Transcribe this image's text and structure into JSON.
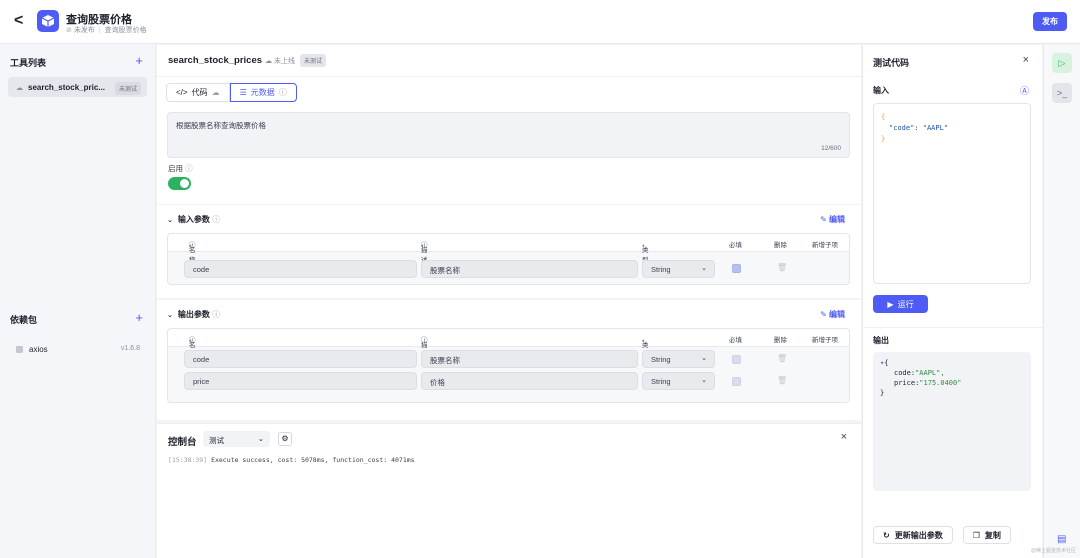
{
  "header": {
    "back_glyph": "<",
    "title": "查询股票价格",
    "status": "未发布",
    "subtitle": "查询股票价格",
    "publish_label": "发布"
  },
  "tools_panel": {
    "title": "工具列表",
    "add_glyph": "+",
    "items": [
      {
        "name": "search_stock_pric...",
        "tag": "未测试"
      }
    ]
  },
  "deps_panel": {
    "title": "依赖包",
    "add_glyph": "+",
    "items": [
      {
        "name": "axios",
        "version": "v1.6.8"
      }
    ]
  },
  "editor": {
    "title": "search_stock_prices",
    "upload_status": "未上线",
    "test_tag": "未测试",
    "tabs": [
      {
        "label": "代码",
        "active": false
      },
      {
        "label": "元数据",
        "active": true
      }
    ],
    "description": "根据股票名称查询股票价格",
    "char_count": "12/600",
    "enable_label": "启用",
    "enabled": true
  },
  "input_params": {
    "title": "输入参数",
    "edit_label": "编辑",
    "headers": {
      "name": "名称",
      "desc": "描述",
      "type": "类型",
      "required": "必填",
      "delete": "删除",
      "add_child": "新增子项"
    },
    "rows": [
      {
        "name": "code",
        "desc": "股票名称",
        "type": "String",
        "required": true
      }
    ]
  },
  "output_params": {
    "title": "输出参数",
    "edit_label": "编辑",
    "headers": {
      "name": "名称",
      "desc": "描述",
      "type": "类型",
      "required": "必填",
      "delete": "删除",
      "add_child": "新增子项"
    },
    "rows": [
      {
        "name": "code",
        "desc": "股票名称",
        "type": "String",
        "required": false
      },
      {
        "name": "price",
        "desc": "价格",
        "type": "String",
        "required": false
      }
    ]
  },
  "console": {
    "title": "控制台",
    "mode": "测试",
    "close_glyph": "×",
    "timestamp": "[15:38:39]",
    "message": "Execute success, cost: 5078ms, function_cost: 4071ms"
  },
  "test_panel": {
    "title": "测试代码",
    "close_glyph": "×",
    "input_label": "输入",
    "input_open": "{",
    "input_key": "\"code\"",
    "input_value": "\"AAPL\"",
    "input_close": "}",
    "run_label": "运行",
    "output_label": "输出",
    "output_open": "{",
    "output_code_key": "code:",
    "output_code_value": "\"AAPL\",",
    "output_price_key": "price:",
    "output_price_value": "\"175.0400\"",
    "output_close": "}",
    "update_button": "更新输出参数",
    "copy_button": "复制"
  },
  "watermark": "@稀土掘金技术社区",
  "colors": {
    "accent": "#4e5bf5",
    "success": "#2bb361",
    "danger": "#e53935"
  }
}
